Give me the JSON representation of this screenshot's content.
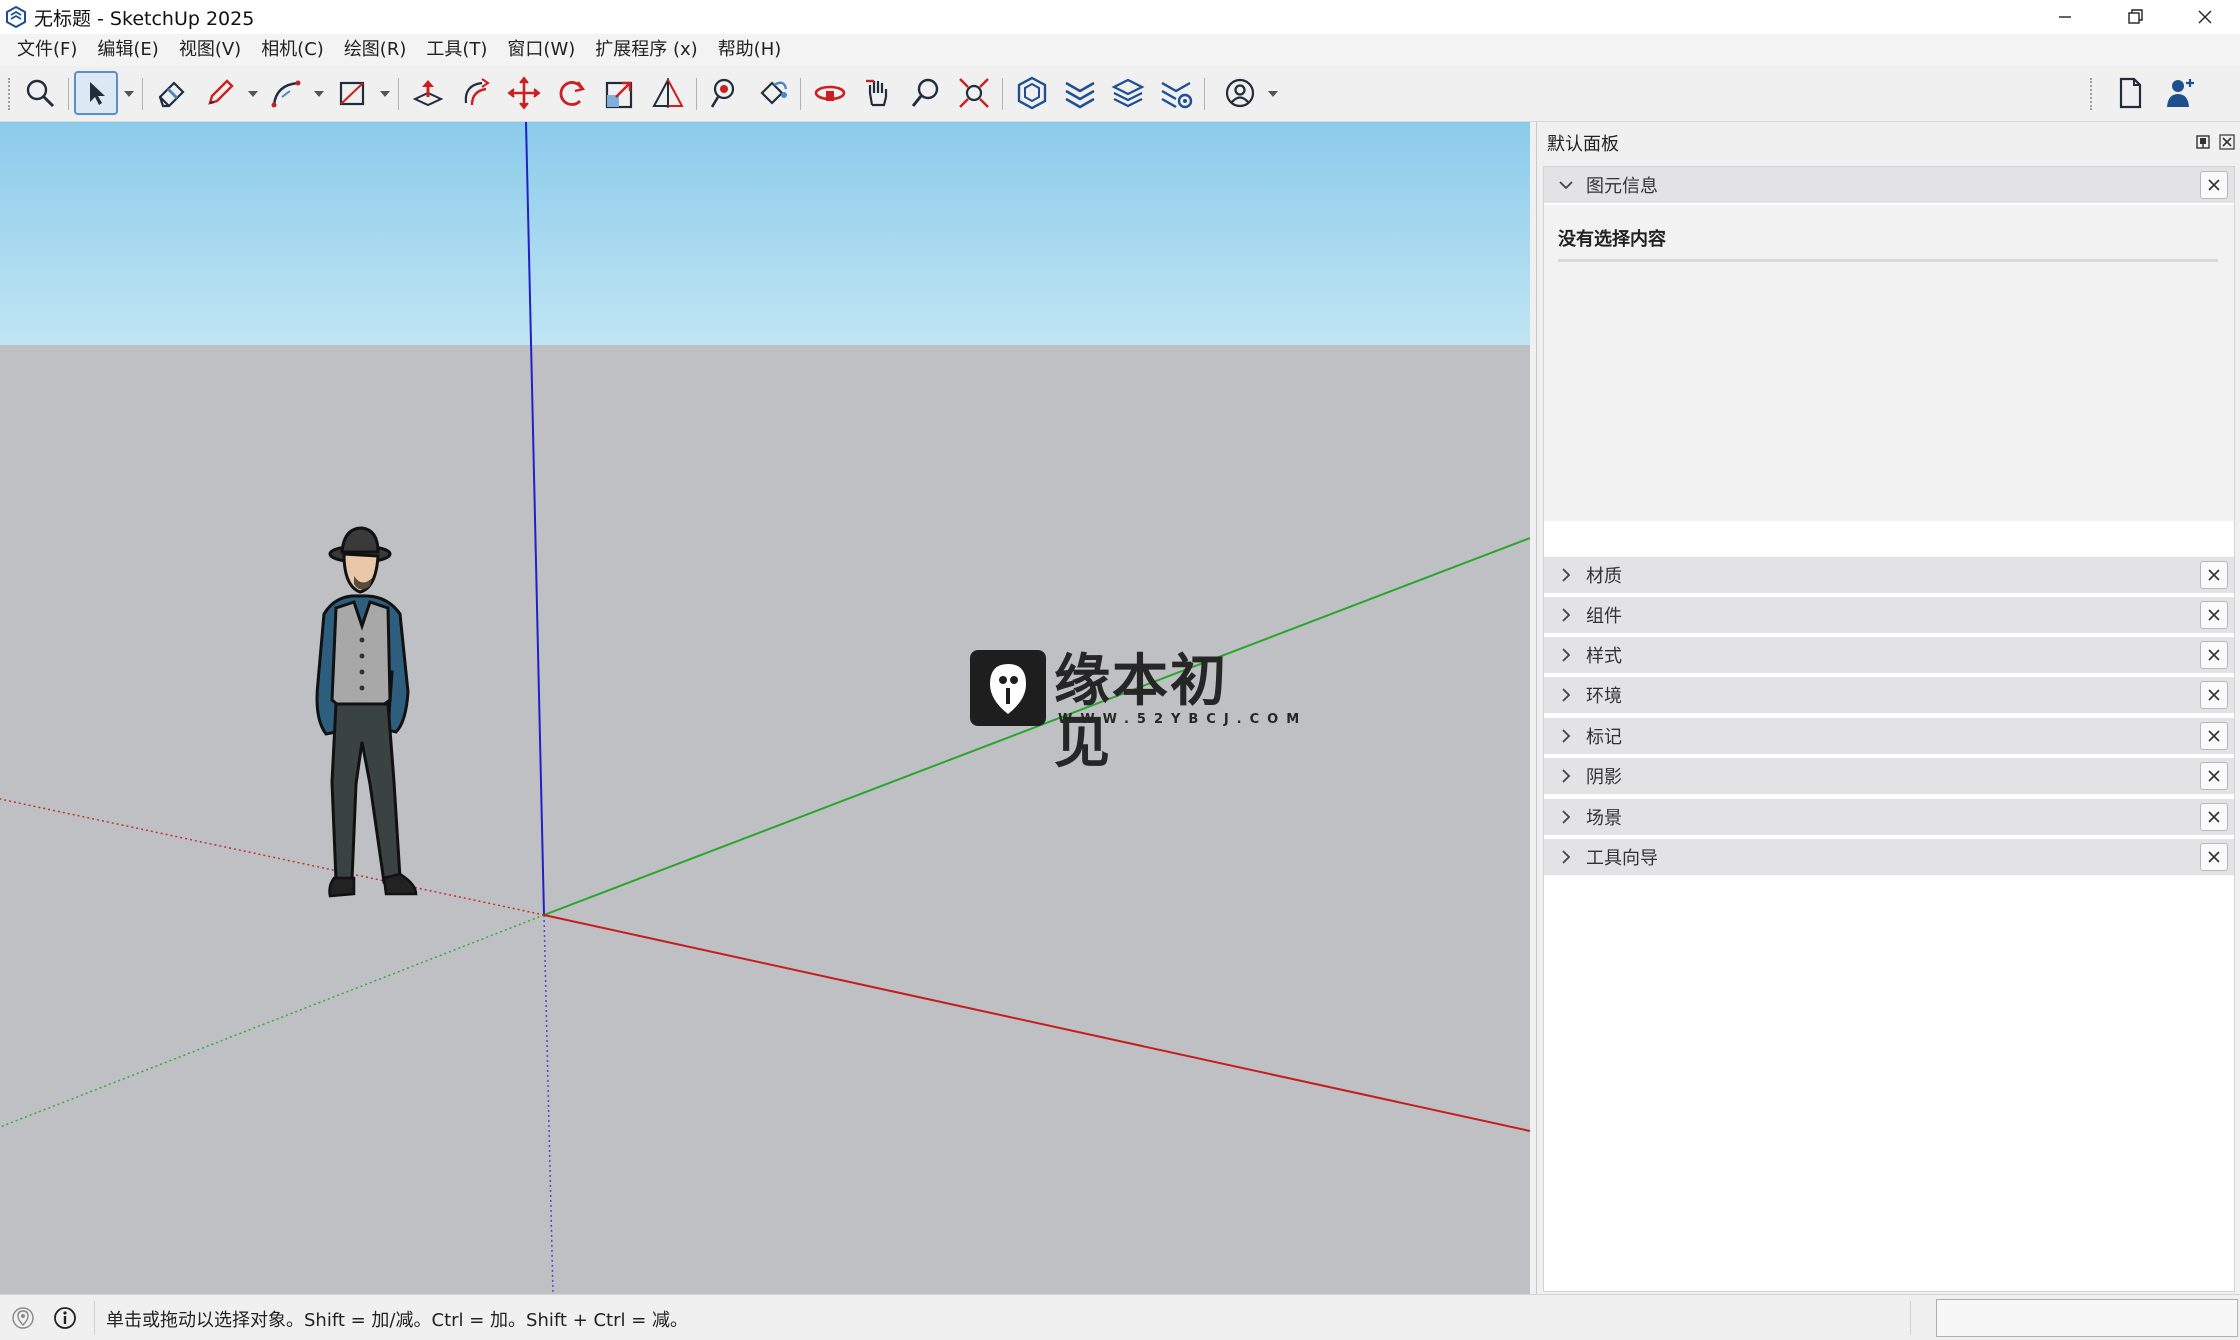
{
  "window": {
    "title": "无标题 - SketchUp 2025"
  },
  "menu": [
    "文件(F)",
    "编辑(E)",
    "视图(V)",
    "相机(C)",
    "绘图(R)",
    "工具(T)",
    "窗口(W)",
    "扩展程序 (x)",
    "帮助(H)"
  ],
  "toolbar": {
    "tools": [
      "search-icon",
      "select-icon",
      "eraser-icon",
      "pencil-icon",
      "arc-icon",
      "rectangle-icon",
      "push-pull-icon",
      "follow-me-icon",
      "move-icon",
      "rotate-icon",
      "scale-icon",
      "offset-icon",
      "tape-measure-icon",
      "paint-bucket-icon",
      "orbit-icon",
      "pan-icon",
      "zoom-icon",
      "zoom-extents-icon",
      "warehouse-icon",
      "extension-warehouse-icon",
      "layout-icon",
      "extension-manager-icon",
      "account-icon",
      "new-file-icon",
      "user-icon"
    ]
  },
  "watermark": {
    "title": "缘本初见",
    "url": "WWW.52YBCJ.COM"
  },
  "panel": {
    "title": "默认面板",
    "entity_info": {
      "label": "图元信息",
      "empty_text": "没有选择内容"
    },
    "sections": [
      "材质",
      "组件",
      "样式",
      "环境",
      "标记",
      "阴影",
      "场景",
      "工具向导"
    ]
  },
  "status": {
    "text": "单击或拖动以选择对象。Shift = 加/减。Ctrl = 加。Shift + Ctrl = 减。"
  },
  "colors": {
    "accent": "#5b8fc7",
    "sky_top": "#8bcbea",
    "ground": "#bfc0c4",
    "axis_red": "#c41e1e",
    "axis_green": "#2aa52a",
    "axis_blue": "#2020c8"
  }
}
